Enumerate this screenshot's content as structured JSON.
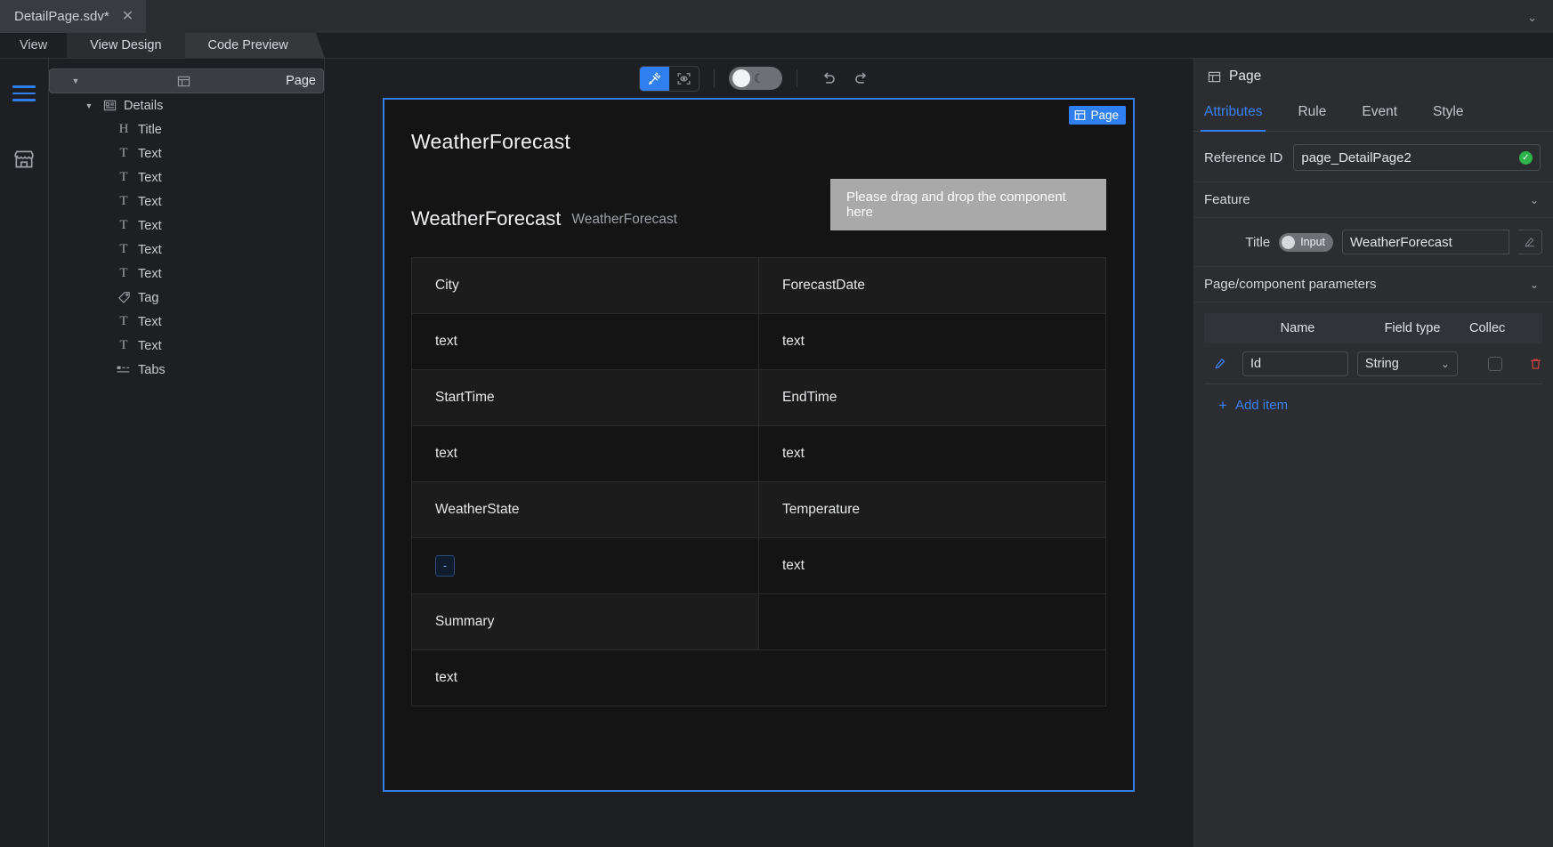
{
  "titlebar": {
    "file_tab": "DetailPage.sdv*",
    "close_icon": "close-icon",
    "collapse_icon": "chevron-down-icon"
  },
  "viewbar": {
    "label": "View",
    "tabs": [
      {
        "label": "View Design",
        "active": false
      },
      {
        "label": "Code Preview",
        "active": true
      }
    ]
  },
  "rail": {
    "items": [
      {
        "icon": "hamburger-menu-icon",
        "name": "outline-toggle"
      },
      {
        "icon": "store-icon",
        "name": "component-store"
      }
    ]
  },
  "tree": {
    "nodes": [
      {
        "label": "Page",
        "icon": "page-icon",
        "depth": 0,
        "expanded": true,
        "selected": true
      },
      {
        "label": "Details",
        "icon": "details-icon",
        "depth": 1,
        "expanded": true,
        "selected": false
      },
      {
        "label": "Title",
        "icon": "heading-icon",
        "depth": 2,
        "expanded": null,
        "selected": false
      },
      {
        "label": "Text",
        "icon": "text-icon",
        "depth": 2,
        "expanded": null,
        "selected": false
      },
      {
        "label": "Text",
        "icon": "text-icon",
        "depth": 2,
        "expanded": null,
        "selected": false
      },
      {
        "label": "Text",
        "icon": "text-icon",
        "depth": 2,
        "expanded": null,
        "selected": false
      },
      {
        "label": "Text",
        "icon": "text-icon",
        "depth": 2,
        "expanded": null,
        "selected": false
      },
      {
        "label": "Text",
        "icon": "text-icon",
        "depth": 2,
        "expanded": null,
        "selected": false
      },
      {
        "label": "Text",
        "icon": "text-icon",
        "depth": 2,
        "expanded": null,
        "selected": false
      },
      {
        "label": "Tag",
        "icon": "tag-icon",
        "depth": 2,
        "expanded": null,
        "selected": false
      },
      {
        "label": "Text",
        "icon": "text-icon",
        "depth": 2,
        "expanded": null,
        "selected": false
      },
      {
        "label": "Text",
        "icon": "text-icon",
        "depth": 2,
        "expanded": null,
        "selected": false
      },
      {
        "label": "Tabs",
        "icon": "tabs-icon",
        "depth": 2,
        "expanded": null,
        "selected": false
      }
    ]
  },
  "toolbar": {
    "design_mode_icon": "wand-icon",
    "preview_mode_icon": "eye-scan-icon",
    "theme_toggle_icon": "moon-icon",
    "undo_icon": "undo-icon",
    "redo_icon": "redo-icon"
  },
  "canvas": {
    "badge": {
      "label": "Page",
      "icon": "page-icon"
    },
    "heading": "WeatherForecast",
    "subheading_main": "WeatherForecast",
    "subheading_alt": "WeatherForecast",
    "dropzone": "Please drag and drop the component here",
    "table": [
      {
        "left": "City",
        "right": "ForecastDate",
        "kind": "hdr"
      },
      {
        "left": "text",
        "right": "text",
        "kind": "val"
      },
      {
        "left": "StartTime",
        "right": "EndTime",
        "kind": "hdr"
      },
      {
        "left": "text",
        "right": "text",
        "kind": "val"
      },
      {
        "left": "WeatherState",
        "right": "Temperature",
        "kind": "hdr"
      },
      {
        "left": "-",
        "right": "text",
        "kind": "val",
        "left_is_tag": true
      },
      {
        "left": "Summary",
        "right": "",
        "kind": "hdr"
      },
      {
        "left": "text",
        "right": "",
        "kind": "val",
        "full_width": true
      }
    ]
  },
  "rightpanel": {
    "title": "Page",
    "title_icon": "page-icon",
    "tabs": [
      {
        "label": "Attributes",
        "active": true
      },
      {
        "label": "Rule",
        "active": false
      },
      {
        "label": "Event",
        "active": false
      },
      {
        "label": "Style",
        "active": false
      }
    ],
    "reference_id": {
      "label": "Reference ID",
      "value": "page_DetailPage2",
      "status_icon": "check-circle-icon"
    },
    "feature_section": {
      "label": "Feature",
      "icon": "chevron-down-icon"
    },
    "feature_title": {
      "label": "Title",
      "toggle_label": "Input",
      "value": "WeatherForecast",
      "edit_icon": "pencil-icon"
    },
    "params_section": {
      "label": "Page/component parameters",
      "icon": "chevron-down-icon"
    },
    "params_table": {
      "columns": [
        "Name",
        "Field type",
        "Collec"
      ],
      "rows": [
        {
          "name": "Id",
          "field_type": "String",
          "collection": false,
          "edit_icon": "pencil-icon",
          "delete_icon": "trash-icon",
          "dropdown_icon": "chevron-down-icon"
        }
      ]
    },
    "add_item": {
      "label": "Add item",
      "icon": "plus-icon"
    }
  },
  "colors": {
    "accent": "#2f7ff0",
    "link": "#3b82f6",
    "success": "#2db34a",
    "danger": "#e0443e",
    "panel_bg": "#2b2d30",
    "app_bg": "#1e1f22",
    "canvas_bg": "#141414"
  }
}
